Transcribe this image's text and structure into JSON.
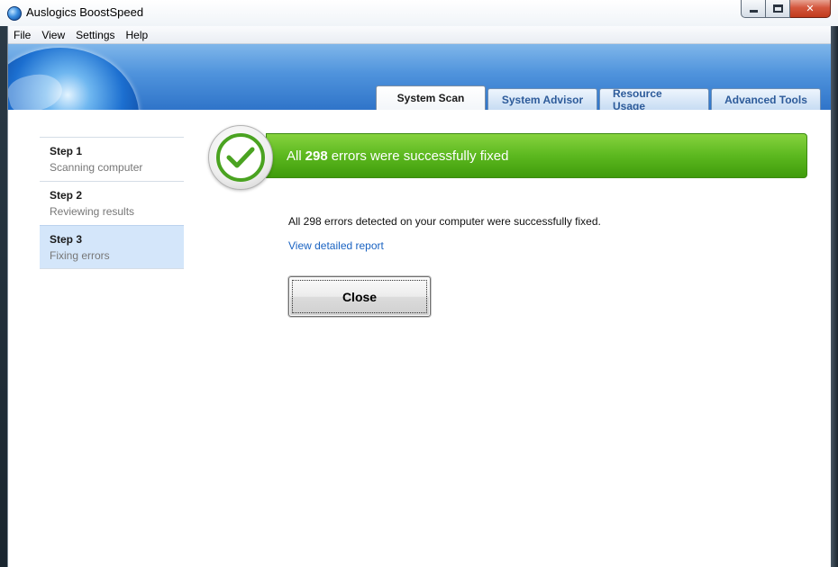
{
  "window": {
    "title": "Auslogics BoostSpeed",
    "controls": {
      "minimize": "minimize-icon",
      "maximize": "maximize-icon",
      "close": "✕"
    }
  },
  "menu": [
    "File",
    "View",
    "Settings",
    "Help"
  ],
  "tabs": [
    {
      "label": "System Scan",
      "active": true
    },
    {
      "label": "System Advisor",
      "active": false
    },
    {
      "label": "Resource Usage",
      "active": false
    },
    {
      "label": "Advanced Tools",
      "active": false
    }
  ],
  "steps": [
    {
      "title": "Step 1",
      "subtitle": "Scanning computer",
      "active": false
    },
    {
      "title": "Step 2",
      "subtitle": "Reviewing results",
      "active": false
    },
    {
      "title": "Step 3",
      "subtitle": "Fixing errors",
      "active": true
    }
  ],
  "result": {
    "banner_prefix": "All",
    "banner_count": "298",
    "banner_suffix": "errors were successfully fixed",
    "detail": "All 298 errors detected on your computer were successfully fixed.",
    "report_link": "View detailed report",
    "close_label": "Close"
  },
  "colors": {
    "success_green": "#5cb81f",
    "link_blue": "#1a63c2",
    "active_step": "#d4e6fa"
  }
}
